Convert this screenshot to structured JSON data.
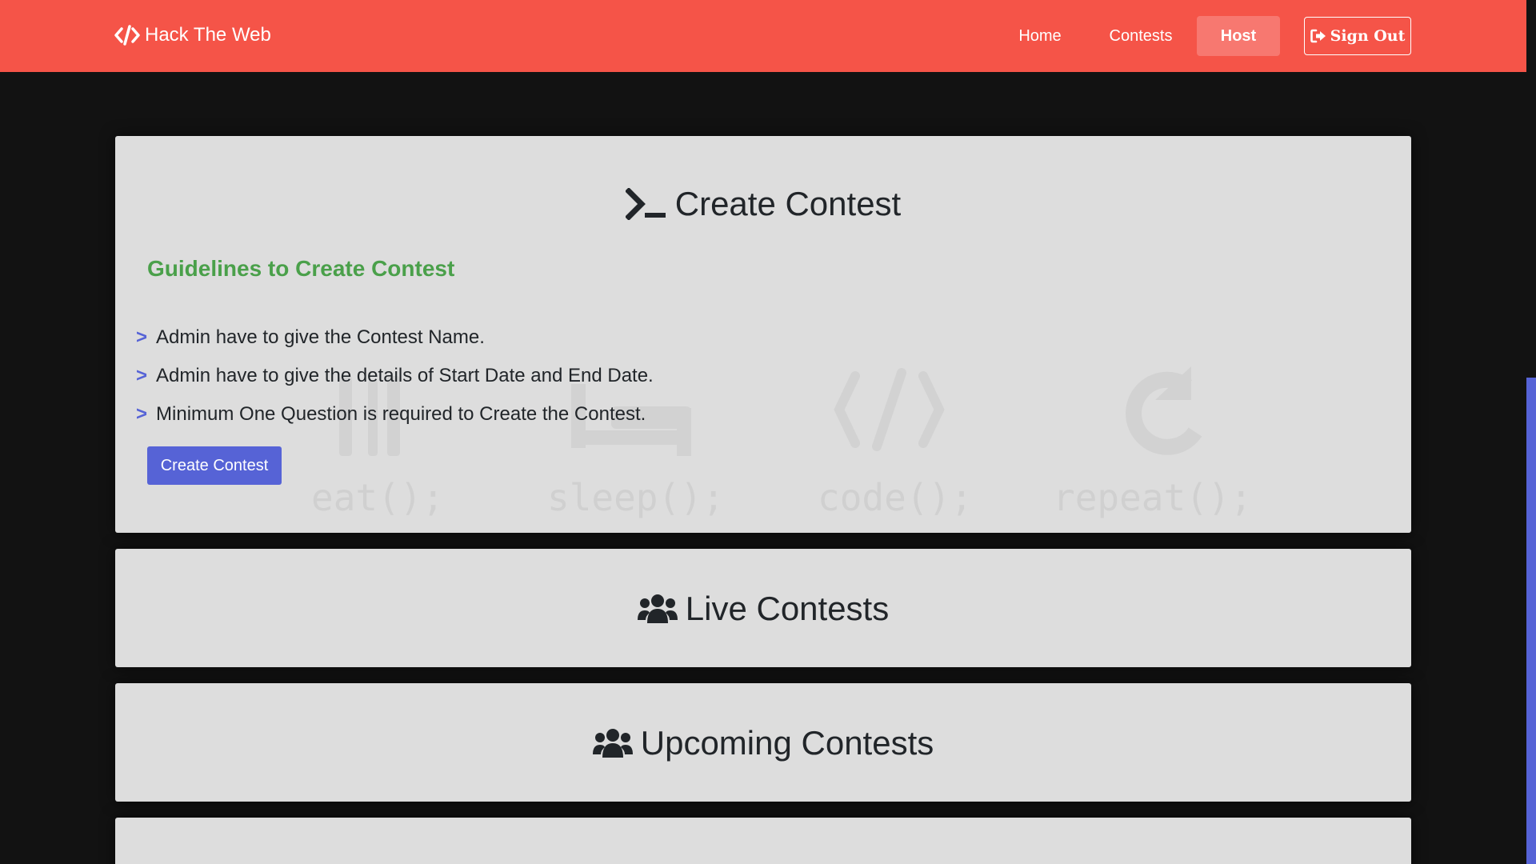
{
  "navbar": {
    "brand": "Hack The Web",
    "links": {
      "home": "Home",
      "contests": "Contests",
      "host": "Host"
    },
    "sign_out": "Sign Out",
    "accent_color": "#f55448"
  },
  "create_card": {
    "title": "Create Contest",
    "guidelines_heading": "Guidelines to Create Contest",
    "rules": [
      "Admin have to give the Contest Name.",
      "Admin have to give the details of Start Date and End Date.",
      "Minimum One Question is required to Create the Contest."
    ],
    "rule_marker": ">",
    "button_label": "Create Contest",
    "watermark_words": [
      "eat();",
      "sleep();",
      "code();",
      "repeat();"
    ]
  },
  "live_card": {
    "title": "Live Contests"
  },
  "upcoming_card": {
    "title": "Upcoming Contests"
  },
  "icons": {
    "brand": "code-icon",
    "sign_out": "sign-out-icon",
    "create": "terminal-icon",
    "live": "users-icon",
    "upcoming": "users-icon"
  },
  "colors": {
    "page_background": "#121212",
    "card_background": "#dddddd",
    "guidelines_green": "#4aa04a",
    "primary_blue": "#5663d6"
  }
}
